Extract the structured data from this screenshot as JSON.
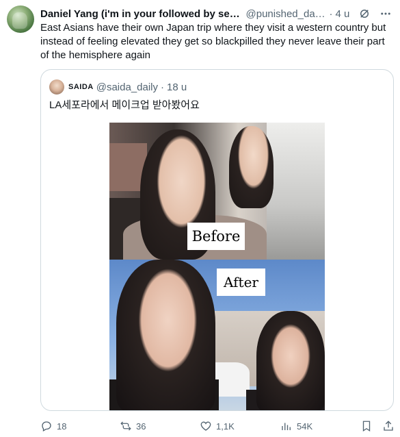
{
  "tweet": {
    "display_name": "Daniel Yang (i'm in your followed by secti...",
    "handle": "@punished_dan...",
    "separator": "·",
    "time": "4 u",
    "text": "East Asians have their own Japan trip where they visit a western country but instead of feeling elevated they get so blackpilled they never leave their part of the hemisphere again"
  },
  "quote": {
    "display_name": "SAIDA",
    "handle": "@saida_daily",
    "separator": "·",
    "time": "18 u",
    "text": "LA세포라에서 메이크업 받아봤어요",
    "image_labels": {
      "before": "Before",
      "after": "After"
    }
  },
  "actions": {
    "replies": "18",
    "reposts": "36",
    "likes": "1,1K",
    "views": "54K"
  },
  "icons": {
    "more": "more-icon",
    "grok": "grok-icon",
    "reply": "reply-icon",
    "repost": "repost-icon",
    "like": "heart-icon",
    "views": "views-icon",
    "bookmark": "bookmark-icon",
    "share": "share-icon"
  },
  "colors": {
    "text_primary": "#0f1419",
    "text_secondary": "#536471",
    "border": "#cfd9de"
  }
}
